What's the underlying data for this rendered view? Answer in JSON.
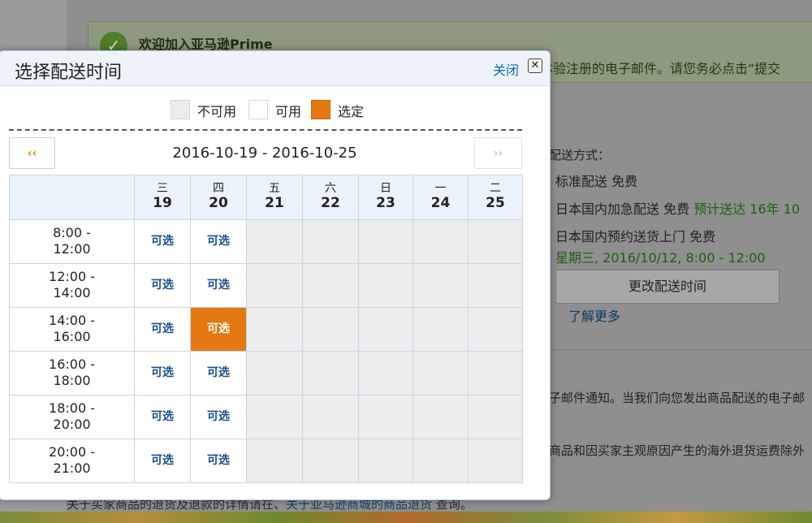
{
  "background": {
    "banner_title": "欢迎加入亚马逊Prime",
    "banner_text": "费体验注册的电子邮件。请您务必点击“提交",
    "delivery_method_label": "配送方式：",
    "standard": "标准配送 免费",
    "express_text": "日本国内加急配送 免费",
    "express_est": "预计送达 16年 10",
    "scheduled_text": "日本国内预约送货上门 免费",
    "scheduled_date": "星期三, 2016/10/12, 8:00 - 12:00",
    "change_button": "更改配送时间",
    "learn_more": "了解更多",
    "email_notice": "子邮件通知。当我们向您发出商品配送的电子邮",
    "return_notice": "商品和因买家主观原因产生的海外退货运费除外",
    "bottom_text": "关于买家商品的退货及退款的详情请在、",
    "bottom_link": "关于亚马逊商城的商品退货",
    "bottom_tail": " 查询。"
  },
  "modal": {
    "title": "选择配送时间",
    "close_label": "关闭",
    "close_icon": "close-x-icon",
    "legend": {
      "unavailable": "不可用",
      "available": "可用",
      "selected": "选定"
    },
    "nav_prev": "‹‹",
    "nav_next": "››",
    "date_range": "2016-10-19 - 2016-10-25",
    "days": [
      {
        "dow": "三",
        "date": "19"
      },
      {
        "dow": "四",
        "date": "20"
      },
      {
        "dow": "五",
        "date": "21"
      },
      {
        "dow": "六",
        "date": "22"
      },
      {
        "dow": "日",
        "date": "23"
      },
      {
        "dow": "一",
        "date": "24"
      },
      {
        "dow": "二",
        "date": "25"
      }
    ],
    "slots": [
      {
        "start": "8:00 -",
        "end": "12:00",
        "cells": [
          "avail",
          "avail",
          "un",
          "un",
          "un",
          "un",
          "un"
        ]
      },
      {
        "start": "12:00 -",
        "end": "14:00",
        "cells": [
          "avail",
          "avail",
          "un",
          "un",
          "un",
          "un",
          "un"
        ]
      },
      {
        "start": "14:00 -",
        "end": "16:00",
        "cells": [
          "avail",
          "selected",
          "un",
          "un",
          "un",
          "un",
          "un"
        ]
      },
      {
        "start": "16:00 -",
        "end": "18:00",
        "cells": [
          "avail",
          "avail",
          "un",
          "un",
          "un",
          "un",
          "un"
        ]
      },
      {
        "start": "18:00 -",
        "end": "20:00",
        "cells": [
          "avail",
          "avail",
          "un",
          "un",
          "un",
          "un",
          "un"
        ]
      },
      {
        "start": "20:00 -",
        "end": "21:00",
        "cells": [
          "avail",
          "avail",
          "un",
          "un",
          "un",
          "un",
          "un"
        ]
      }
    ],
    "slot_label": "可选"
  },
  "colors": {
    "accent": "#e47911",
    "link": "#0a6ab3",
    "unavailable": "#ececec"
  }
}
